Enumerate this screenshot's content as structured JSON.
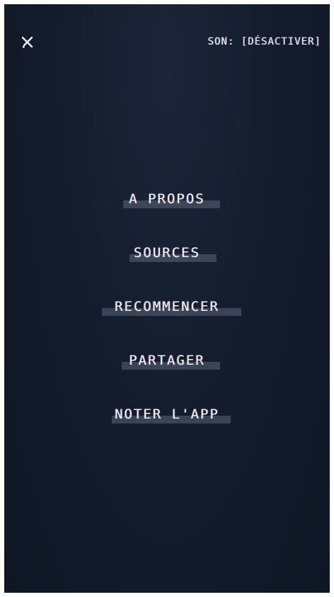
{
  "header": {
    "close_icon": "close-icon",
    "sound_toggle_label": "SON: [DÉSACTIVER]"
  },
  "menu": {
    "items": [
      {
        "label": "A PROPOS"
      },
      {
        "label": "SOURCES"
      },
      {
        "label": "RECOMMENCER"
      },
      {
        "label": "PARTAGER"
      },
      {
        "label": "NOTER L'APP"
      }
    ]
  },
  "colors": {
    "background": "#141d2d",
    "text": "#eef1f6",
    "highlight_bar": "#4b5466"
  }
}
